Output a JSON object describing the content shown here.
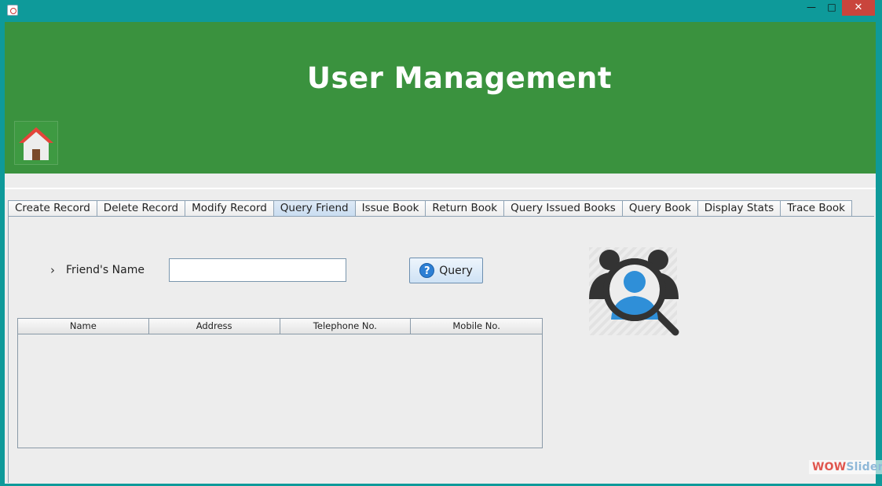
{
  "window": {
    "minimize_glyph": "—",
    "maximize_glyph": "□",
    "close_glyph": "✕"
  },
  "banner": {
    "title": "User Management",
    "home_icon": "home-icon",
    "color": "#3a923e"
  },
  "tabs": [
    {
      "label": "Create Record"
    },
    {
      "label": "Delete Record"
    },
    {
      "label": "Modify Record"
    },
    {
      "label": "Query Friend",
      "active": true
    },
    {
      "label": "Issue Book"
    },
    {
      "label": "Return Book"
    },
    {
      "label": "Query Issued Books"
    },
    {
      "label": "Query Book"
    },
    {
      "label": "Display Stats"
    },
    {
      "label": "Trace Book"
    }
  ],
  "form": {
    "chevron": "›",
    "friend_name_label": "Friend's Name",
    "friend_name_value": "",
    "query_button_label": "Query",
    "query_icon_glyph": "?"
  },
  "table": {
    "columns": [
      "Name",
      "Address",
      "Telephone No.",
      "Mobile No."
    ],
    "rows": []
  },
  "illustration": "people-search-icon",
  "watermark": {
    "part1": "WOW",
    "part2": "Slider"
  }
}
